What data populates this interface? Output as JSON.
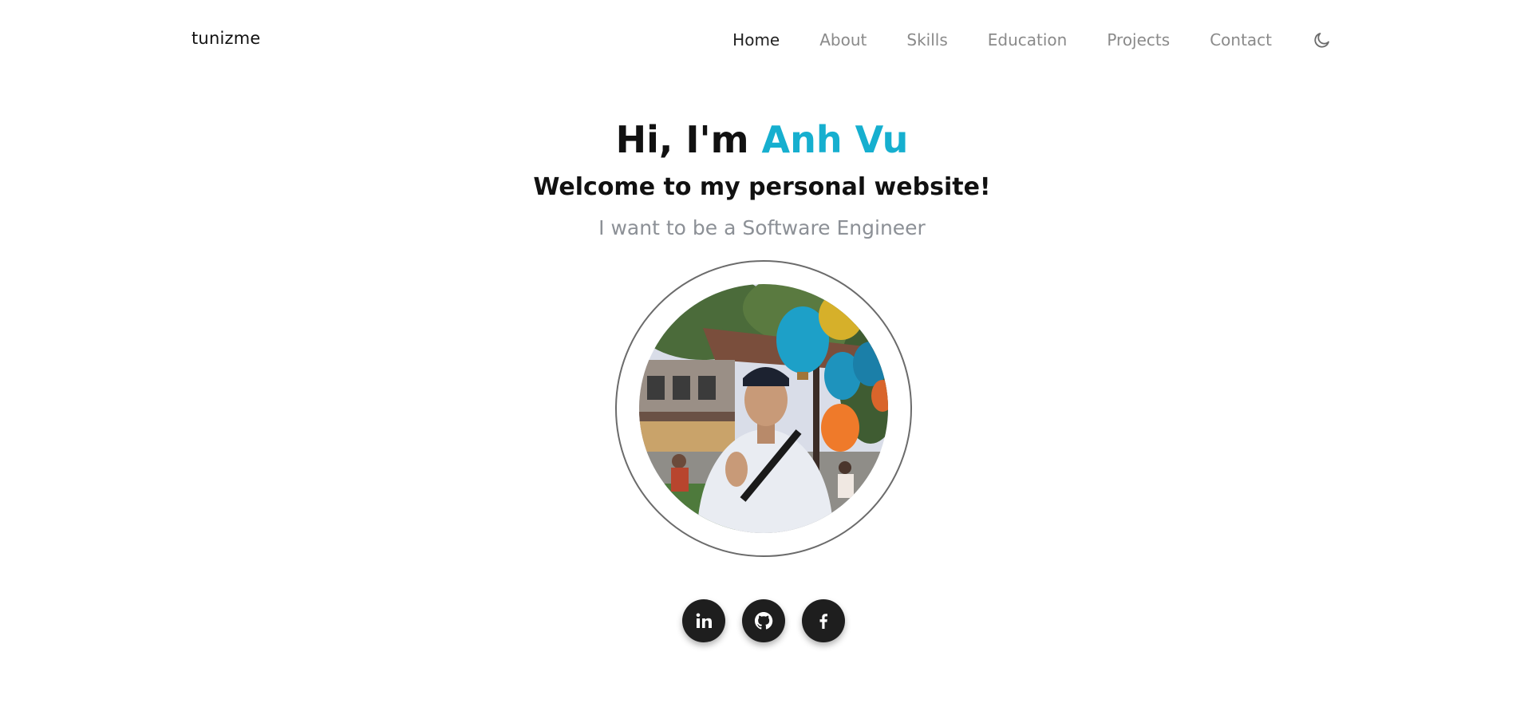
{
  "brand": "tunizme",
  "nav": {
    "items": [
      {
        "label": "Home",
        "active": true
      },
      {
        "label": "About",
        "active": false
      },
      {
        "label": "Skills",
        "active": false
      },
      {
        "label": "Education",
        "active": false
      },
      {
        "label": "Projects",
        "active": false
      },
      {
        "label": "Contact",
        "active": false
      }
    ],
    "theme_icon": "moon-icon"
  },
  "hero": {
    "greeting": "Hi, I'm",
    "name": "Anh Vu",
    "subtitle": "Welcome to my personal website!",
    "tagline": "I want to be a Software Engineer"
  },
  "social": [
    {
      "icon": "linkedin-icon"
    },
    {
      "icon": "github-icon"
    },
    {
      "icon": "facebook-icon"
    }
  ],
  "colors": {
    "accent": "#16afcf",
    "text": "#111111",
    "muted": "#8c9096",
    "button": "#1e1e1e"
  }
}
